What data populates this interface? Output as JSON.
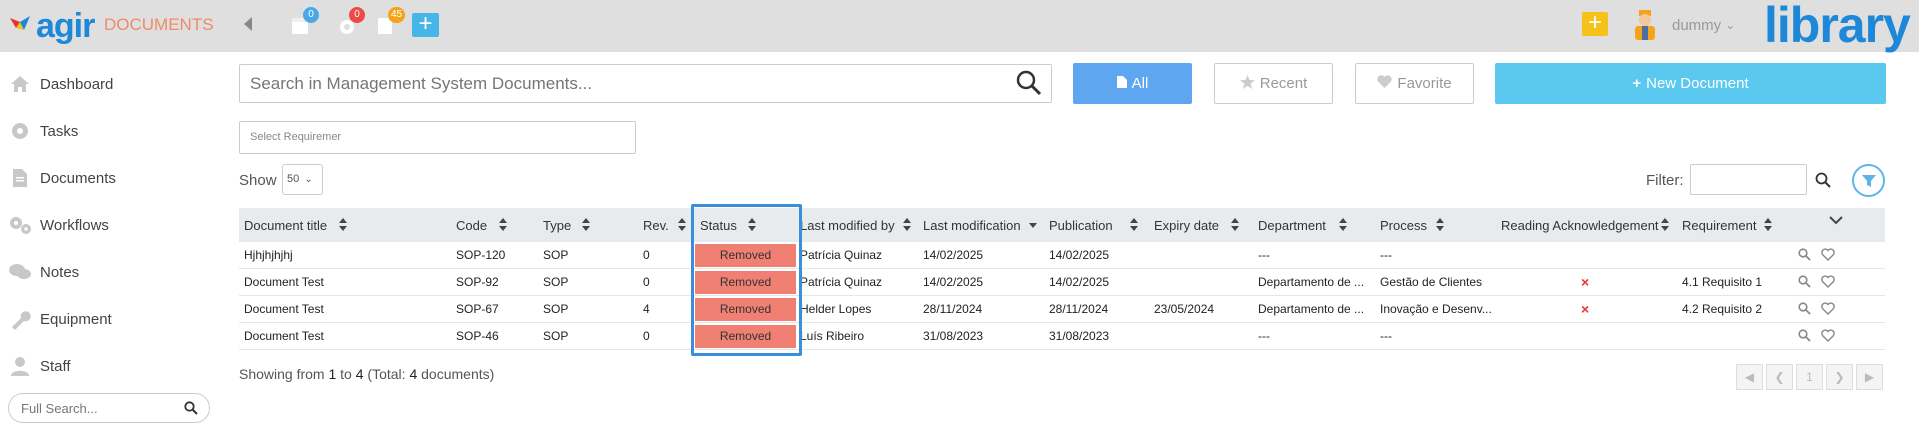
{
  "app": {
    "logo_text": "agir",
    "module_title": "DOCUMENTS",
    "library_logo": "library"
  },
  "topbar": {
    "badges": {
      "calendar": "0",
      "settings": "0",
      "docs": "45"
    },
    "user_name": "dummy"
  },
  "sidebar": {
    "items": [
      {
        "label": "Dashboard",
        "icon": "home-icon"
      },
      {
        "label": "Tasks",
        "icon": "gear-icon"
      },
      {
        "label": "Documents",
        "icon": "document-icon"
      },
      {
        "label": "Workflows",
        "icon": "gears-icon"
      },
      {
        "label": "Notes",
        "icon": "chat-icon"
      },
      {
        "label": "Equipment",
        "icon": "wrench-icon"
      },
      {
        "label": "Staff",
        "icon": "user-icon"
      }
    ],
    "full_search_placeholder": "Full Search..."
  },
  "search": {
    "placeholder": "Search in Management System Documents..."
  },
  "buttons": {
    "all": "All",
    "recent": "Recent",
    "favorite": "Favorite",
    "new_document": "New Document"
  },
  "requirement_select": "Select Requiremer",
  "show": {
    "label": "Show",
    "value": "50"
  },
  "filter": {
    "label": "Filter:"
  },
  "table": {
    "headers": {
      "title": "Document title",
      "code": "Code",
      "type": "Type",
      "rev": "Rev.",
      "status": "Status",
      "modified_by": "Last modified by",
      "last_mod": "Last modification",
      "publication": "Publication",
      "expiry": "Expiry date",
      "department": "Department",
      "process": "Process",
      "reading": "Reading Acknowledgement",
      "requirement": "Requirement"
    },
    "rows": [
      {
        "title": "Hjhjhjhjhj",
        "code": "SOP-120",
        "type": "SOP",
        "rev": "0",
        "status": "Removed",
        "modified_by": "Patrícia Quinaz",
        "last_mod": "14/02/2025",
        "publication": "14/02/2025",
        "expiry": "",
        "department": "---",
        "process": "---",
        "reading": "",
        "requirement": ""
      },
      {
        "title": "Document Test",
        "code": "SOP-92",
        "type": "SOP",
        "rev": "0",
        "status": "Removed",
        "modified_by": "Patrícia Quinaz",
        "last_mod": "14/02/2025",
        "publication": "14/02/2025",
        "expiry": "",
        "department": "Departamento de ...",
        "process": "Gestão de Clientes",
        "reading": "×",
        "requirement": "4.1 Requisito 1"
      },
      {
        "title": "Document Test",
        "code": "SOP-67",
        "type": "SOP",
        "rev": "4",
        "status": "Removed",
        "modified_by": "Helder Lopes",
        "last_mod": "28/11/2024",
        "publication": "28/11/2024",
        "expiry": "23/05/2024",
        "department": "Departamento de ...",
        "process": "Inovação e Desenv...",
        "reading": "×",
        "requirement": "4.2 Requisito 2"
      },
      {
        "title": "Document Test",
        "code": "SOP-46",
        "type": "SOP",
        "rev": "0",
        "status": "Removed",
        "modified_by": "Luís Ribeiro",
        "last_mod": "31/08/2023",
        "publication": "31/08/2023",
        "expiry": "",
        "department": "---",
        "process": "---",
        "reading": "",
        "requirement": ""
      }
    ]
  },
  "footer": {
    "prefix": "Showing from ",
    "from": "1",
    "to_word": " to ",
    "to": "4",
    "total_prefix": " (Total: ",
    "total": "4",
    "total_suffix": " documents)"
  },
  "pagination": {
    "current_page": "1"
  },
  "colors": {
    "status_removed": "#f08074",
    "accent_blue": "#5ea7f0",
    "new_doc_blue": "#5bc8ef",
    "brand_blue": "#1d87d8",
    "highlight": "#3a8fd8"
  }
}
